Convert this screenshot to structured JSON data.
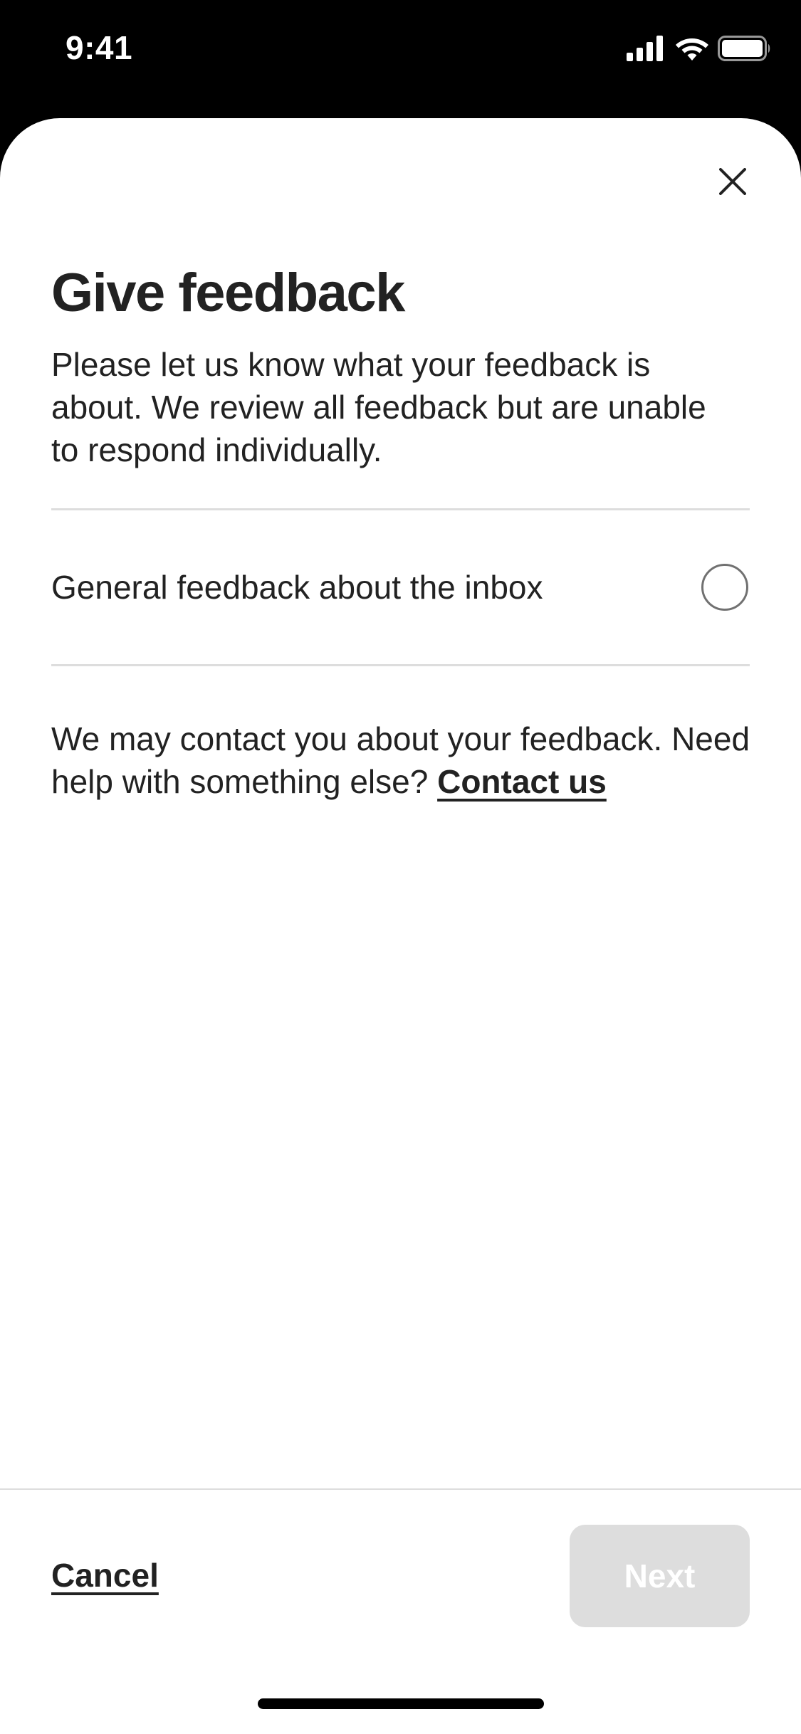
{
  "status_bar": {
    "time": "9:41",
    "icons": [
      "signal-icon",
      "wifi-icon",
      "battery-icon"
    ]
  },
  "sheet": {
    "close_icon": "close-icon",
    "title": "Give feedback",
    "description": "Please let us know what your feedback is about. We review all feedback but are unable to respond individually.",
    "options": [
      {
        "label": "General feedback about the inbox",
        "selected": false
      }
    ],
    "contact_text": "We may contact you about your feedback. Need help with something else?",
    "contact_link": "Contact us"
  },
  "footer": {
    "cancel_label": "Cancel",
    "next_label": "Next",
    "next_enabled": false
  },
  "colors": {
    "text": "#222222",
    "divider": "#dddddd",
    "radio_border": "#717171",
    "disabled_button": "#dddddd",
    "status_bar_bg": "#000000"
  }
}
